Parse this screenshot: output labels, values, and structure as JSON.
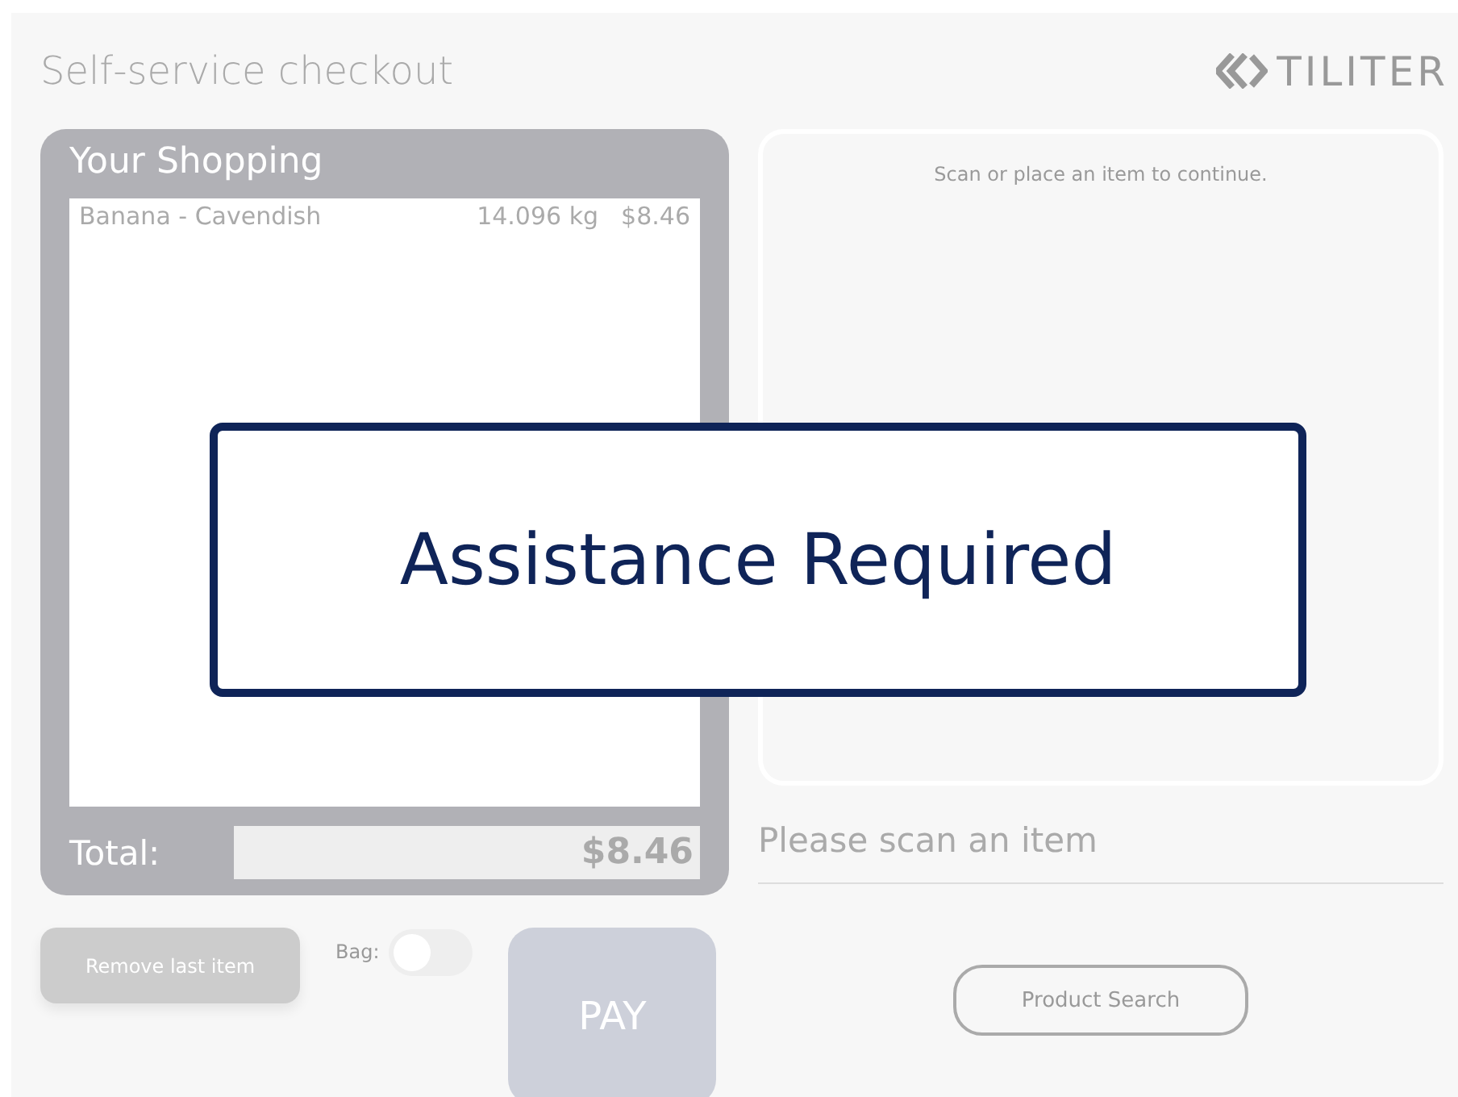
{
  "header": {
    "title": "Self-service checkout",
    "logo": "TILITER"
  },
  "cart": {
    "title": "Your Shopping",
    "items": [
      {
        "name": "Banana - Cavendish",
        "weight": "14.096 kg",
        "price": "$8.46"
      }
    ],
    "total_label": "Total:",
    "total": "$8.46"
  },
  "actions": {
    "remove": "Remove last item",
    "bag": {
      "label": "Bag:",
      "on": false
    },
    "pay": "PAY"
  },
  "scan_area": {
    "message": "Scan or place an item to continue."
  },
  "prompt": "Please scan an item",
  "product_search": "Product Search",
  "alert": {
    "message": "Assistance Required"
  }
}
